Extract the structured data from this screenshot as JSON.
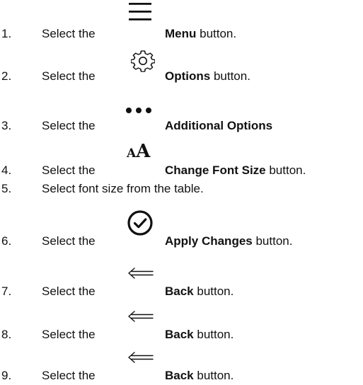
{
  "steps": [
    {
      "number": "1.",
      "lead": "Select the",
      "bold": "Menu",
      "rest": " button.",
      "icon": "hamburger-menu-icon"
    },
    {
      "number": "2.",
      "lead": "Select the",
      "bold": "Options",
      "rest": " button.",
      "icon": "gear-icon"
    },
    {
      "number": "3.",
      "lead": "Select the",
      "bold": "Additional Options",
      "rest": "",
      "icon": "ellipsis-icon"
    },
    {
      "number": "4.",
      "lead": "Select the",
      "bold": "Change Font Size",
      "rest": " button.",
      "icon": "font-size-icon",
      "icon_text": "AA"
    },
    {
      "number": "5.",
      "text": "Select font size from the table."
    },
    {
      "number": "6.",
      "lead": "Select the",
      "bold": "Apply Changes",
      "rest": " button.",
      "icon": "check-circle-icon"
    },
    {
      "number": "7.",
      "lead": "Select the",
      "bold": "Back",
      "rest": " button.",
      "icon": "back-arrow-icon"
    },
    {
      "number": "8.",
      "lead": "Select the",
      "bold": "Back",
      "rest": " button.",
      "icon": "back-arrow-icon"
    },
    {
      "number": "9.",
      "lead": "Select the",
      "bold": "Back",
      "rest": " button.",
      "icon": "back-arrow-icon"
    }
  ]
}
